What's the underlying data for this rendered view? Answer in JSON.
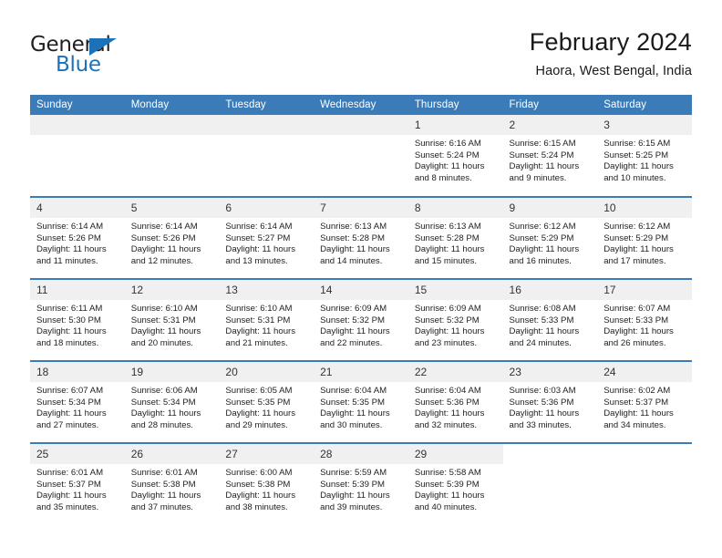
{
  "logo": {
    "word_one": "General",
    "word_two": "Blue",
    "triangle_color": "#1b72b8",
    "text_color": "#231f20",
    "icon": "general-blue-logo"
  },
  "header": {
    "title": "February 2024",
    "subtitle": "Haora, West Bengal, India"
  },
  "theme": {
    "header_blue": "#3b7cb8",
    "daynum_band": "#f0f0f0",
    "text": "#222222",
    "page_bg": "#ffffff"
  },
  "weekday_headers": [
    "Sunday",
    "Monday",
    "Tuesday",
    "Wednesday",
    "Thursday",
    "Friday",
    "Saturday"
  ],
  "weeks": [
    [
      {
        "day": "",
        "empty": true
      },
      {
        "day": "",
        "empty": true
      },
      {
        "day": "",
        "empty": true
      },
      {
        "day": "",
        "empty": true
      },
      {
        "day": "1",
        "sunrise": "Sunrise: 6:16 AM",
        "sunset": "Sunset: 5:24 PM",
        "daylight_line1": "Daylight: 11 hours",
        "daylight_line2": "and 8 minutes."
      },
      {
        "day": "2",
        "sunrise": "Sunrise: 6:15 AM",
        "sunset": "Sunset: 5:24 PM",
        "daylight_line1": "Daylight: 11 hours",
        "daylight_line2": "and 9 minutes."
      },
      {
        "day": "3",
        "sunrise": "Sunrise: 6:15 AM",
        "sunset": "Sunset: 5:25 PM",
        "daylight_line1": "Daylight: 11 hours",
        "daylight_line2": "and 10 minutes."
      }
    ],
    [
      {
        "day": "4",
        "sunrise": "Sunrise: 6:14 AM",
        "sunset": "Sunset: 5:26 PM",
        "daylight_line1": "Daylight: 11 hours",
        "daylight_line2": "and 11 minutes."
      },
      {
        "day": "5",
        "sunrise": "Sunrise: 6:14 AM",
        "sunset": "Sunset: 5:26 PM",
        "daylight_line1": "Daylight: 11 hours",
        "daylight_line2": "and 12 minutes."
      },
      {
        "day": "6",
        "sunrise": "Sunrise: 6:14 AM",
        "sunset": "Sunset: 5:27 PM",
        "daylight_line1": "Daylight: 11 hours",
        "daylight_line2": "and 13 minutes."
      },
      {
        "day": "7",
        "sunrise": "Sunrise: 6:13 AM",
        "sunset": "Sunset: 5:28 PM",
        "daylight_line1": "Daylight: 11 hours",
        "daylight_line2": "and 14 minutes."
      },
      {
        "day": "8",
        "sunrise": "Sunrise: 6:13 AM",
        "sunset": "Sunset: 5:28 PM",
        "daylight_line1": "Daylight: 11 hours",
        "daylight_line2": "and 15 minutes."
      },
      {
        "day": "9",
        "sunrise": "Sunrise: 6:12 AM",
        "sunset": "Sunset: 5:29 PM",
        "daylight_line1": "Daylight: 11 hours",
        "daylight_line2": "and 16 minutes."
      },
      {
        "day": "10",
        "sunrise": "Sunrise: 6:12 AM",
        "sunset": "Sunset: 5:29 PM",
        "daylight_line1": "Daylight: 11 hours",
        "daylight_line2": "and 17 minutes."
      }
    ],
    [
      {
        "day": "11",
        "sunrise": "Sunrise: 6:11 AM",
        "sunset": "Sunset: 5:30 PM",
        "daylight_line1": "Daylight: 11 hours",
        "daylight_line2": "and 18 minutes."
      },
      {
        "day": "12",
        "sunrise": "Sunrise: 6:10 AM",
        "sunset": "Sunset: 5:31 PM",
        "daylight_line1": "Daylight: 11 hours",
        "daylight_line2": "and 20 minutes."
      },
      {
        "day": "13",
        "sunrise": "Sunrise: 6:10 AM",
        "sunset": "Sunset: 5:31 PM",
        "daylight_line1": "Daylight: 11 hours",
        "daylight_line2": "and 21 minutes."
      },
      {
        "day": "14",
        "sunrise": "Sunrise: 6:09 AM",
        "sunset": "Sunset: 5:32 PM",
        "daylight_line1": "Daylight: 11 hours",
        "daylight_line2": "and 22 minutes."
      },
      {
        "day": "15",
        "sunrise": "Sunrise: 6:09 AM",
        "sunset": "Sunset: 5:32 PM",
        "daylight_line1": "Daylight: 11 hours",
        "daylight_line2": "and 23 minutes."
      },
      {
        "day": "16",
        "sunrise": "Sunrise: 6:08 AM",
        "sunset": "Sunset: 5:33 PM",
        "daylight_line1": "Daylight: 11 hours",
        "daylight_line2": "and 24 minutes."
      },
      {
        "day": "17",
        "sunrise": "Sunrise: 6:07 AM",
        "sunset": "Sunset: 5:33 PM",
        "daylight_line1": "Daylight: 11 hours",
        "daylight_line2": "and 26 minutes."
      }
    ],
    [
      {
        "day": "18",
        "sunrise": "Sunrise: 6:07 AM",
        "sunset": "Sunset: 5:34 PM",
        "daylight_line1": "Daylight: 11 hours",
        "daylight_line2": "and 27 minutes."
      },
      {
        "day": "19",
        "sunrise": "Sunrise: 6:06 AM",
        "sunset": "Sunset: 5:34 PM",
        "daylight_line1": "Daylight: 11 hours",
        "daylight_line2": "and 28 minutes."
      },
      {
        "day": "20",
        "sunrise": "Sunrise: 6:05 AM",
        "sunset": "Sunset: 5:35 PM",
        "daylight_line1": "Daylight: 11 hours",
        "daylight_line2": "and 29 minutes."
      },
      {
        "day": "21",
        "sunrise": "Sunrise: 6:04 AM",
        "sunset": "Sunset: 5:35 PM",
        "daylight_line1": "Daylight: 11 hours",
        "daylight_line2": "and 30 minutes."
      },
      {
        "day": "22",
        "sunrise": "Sunrise: 6:04 AM",
        "sunset": "Sunset: 5:36 PM",
        "daylight_line1": "Daylight: 11 hours",
        "daylight_line2": "and 32 minutes."
      },
      {
        "day": "23",
        "sunrise": "Sunrise: 6:03 AM",
        "sunset": "Sunset: 5:36 PM",
        "daylight_line1": "Daylight: 11 hours",
        "daylight_line2": "and 33 minutes."
      },
      {
        "day": "24",
        "sunrise": "Sunrise: 6:02 AM",
        "sunset": "Sunset: 5:37 PM",
        "daylight_line1": "Daylight: 11 hours",
        "daylight_line2": "and 34 minutes."
      }
    ],
    [
      {
        "day": "25",
        "sunrise": "Sunrise: 6:01 AM",
        "sunset": "Sunset: 5:37 PM",
        "daylight_line1": "Daylight: 11 hours",
        "daylight_line2": "and 35 minutes."
      },
      {
        "day": "26",
        "sunrise": "Sunrise: 6:01 AM",
        "sunset": "Sunset: 5:38 PM",
        "daylight_line1": "Daylight: 11 hours",
        "daylight_line2": "and 37 minutes."
      },
      {
        "day": "27",
        "sunrise": "Sunrise: 6:00 AM",
        "sunset": "Sunset: 5:38 PM",
        "daylight_line1": "Daylight: 11 hours",
        "daylight_line2": "and 38 minutes."
      },
      {
        "day": "28",
        "sunrise": "Sunrise: 5:59 AM",
        "sunset": "Sunset: 5:39 PM",
        "daylight_line1": "Daylight: 11 hours",
        "daylight_line2": "and 39 minutes."
      },
      {
        "day": "29",
        "sunrise": "Sunrise: 5:58 AM",
        "sunset": "Sunset: 5:39 PM",
        "daylight_line1": "Daylight: 11 hours",
        "daylight_line2": "and 40 minutes."
      },
      {
        "day": "",
        "empty": true,
        "blank_no_band": true
      },
      {
        "day": "",
        "empty": true,
        "blank_no_band": true
      }
    ]
  ]
}
